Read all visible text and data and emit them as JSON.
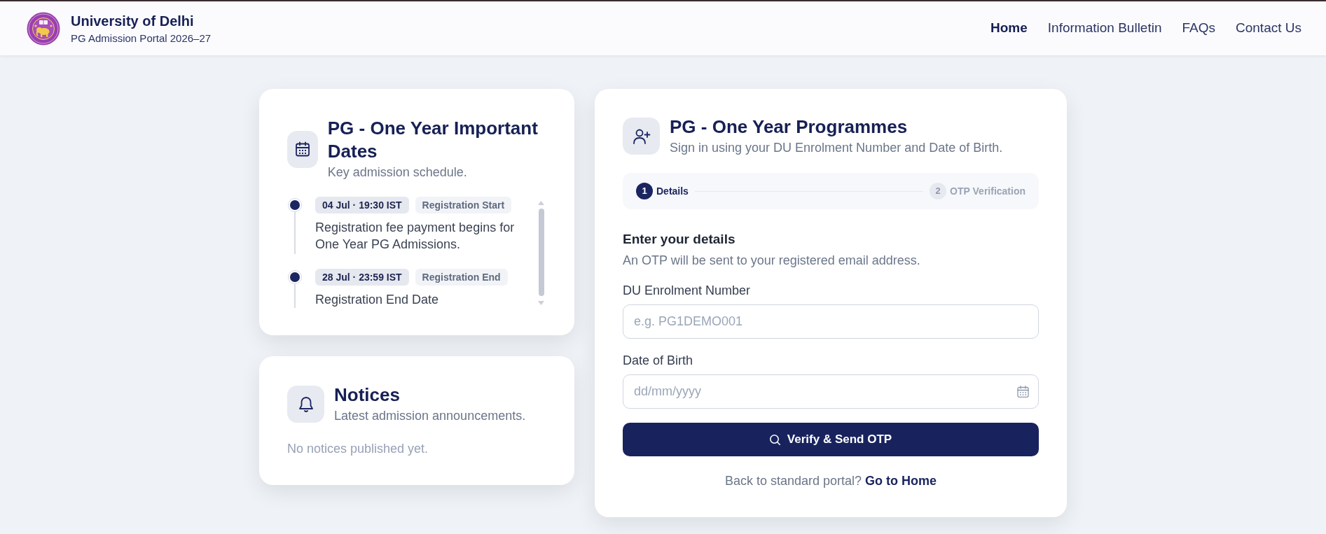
{
  "header": {
    "title": "University of Delhi",
    "subtitle": "PG Admission Portal 2026–27",
    "nav": [
      {
        "label": "Home",
        "selected": true
      },
      {
        "label": "Information Bulletin",
        "selected": false
      },
      {
        "label": "FAQs",
        "selected": false
      },
      {
        "label": "Contact Us",
        "selected": false
      }
    ]
  },
  "dates_card": {
    "title": "PG - One Year Important Dates",
    "subtitle": "Key admission schedule.",
    "events": [
      {
        "date": "04 Jul · 19:30 IST",
        "tag": "Registration Start",
        "description": "Registration fee payment begins for One Year PG Admissions."
      },
      {
        "date": "28 Jul · 23:59 IST",
        "tag": "Registration End",
        "description": "Registration End Date"
      }
    ]
  },
  "notices_card": {
    "title": "Notices",
    "subtitle": "Latest admission announcements.",
    "empty_message": "No notices published yet."
  },
  "login_card": {
    "title": "PG - One Year Programmes",
    "subtitle": "Sign in using your DU Enrolment Number and Date of Birth.",
    "steps": [
      {
        "number": "1",
        "label": "Details",
        "selected": true
      },
      {
        "number": "2",
        "label": "OTP Verification",
        "selected": false
      }
    ],
    "heading": "Enter your details",
    "hint": "An OTP will be sent to your registered email address.",
    "fields": [
      {
        "kind": "text",
        "label": "DU Enrolment Number",
        "placeholder": "e.g. PG1DEMO001"
      },
      {
        "kind": "date",
        "label": "Date of Birth",
        "placeholder": "dd/mm/yyyy"
      }
    ],
    "submit_button": "Verify & Send OTP",
    "footer": {
      "text": "Back to standard portal?",
      "link": "Go to Home"
    }
  }
}
